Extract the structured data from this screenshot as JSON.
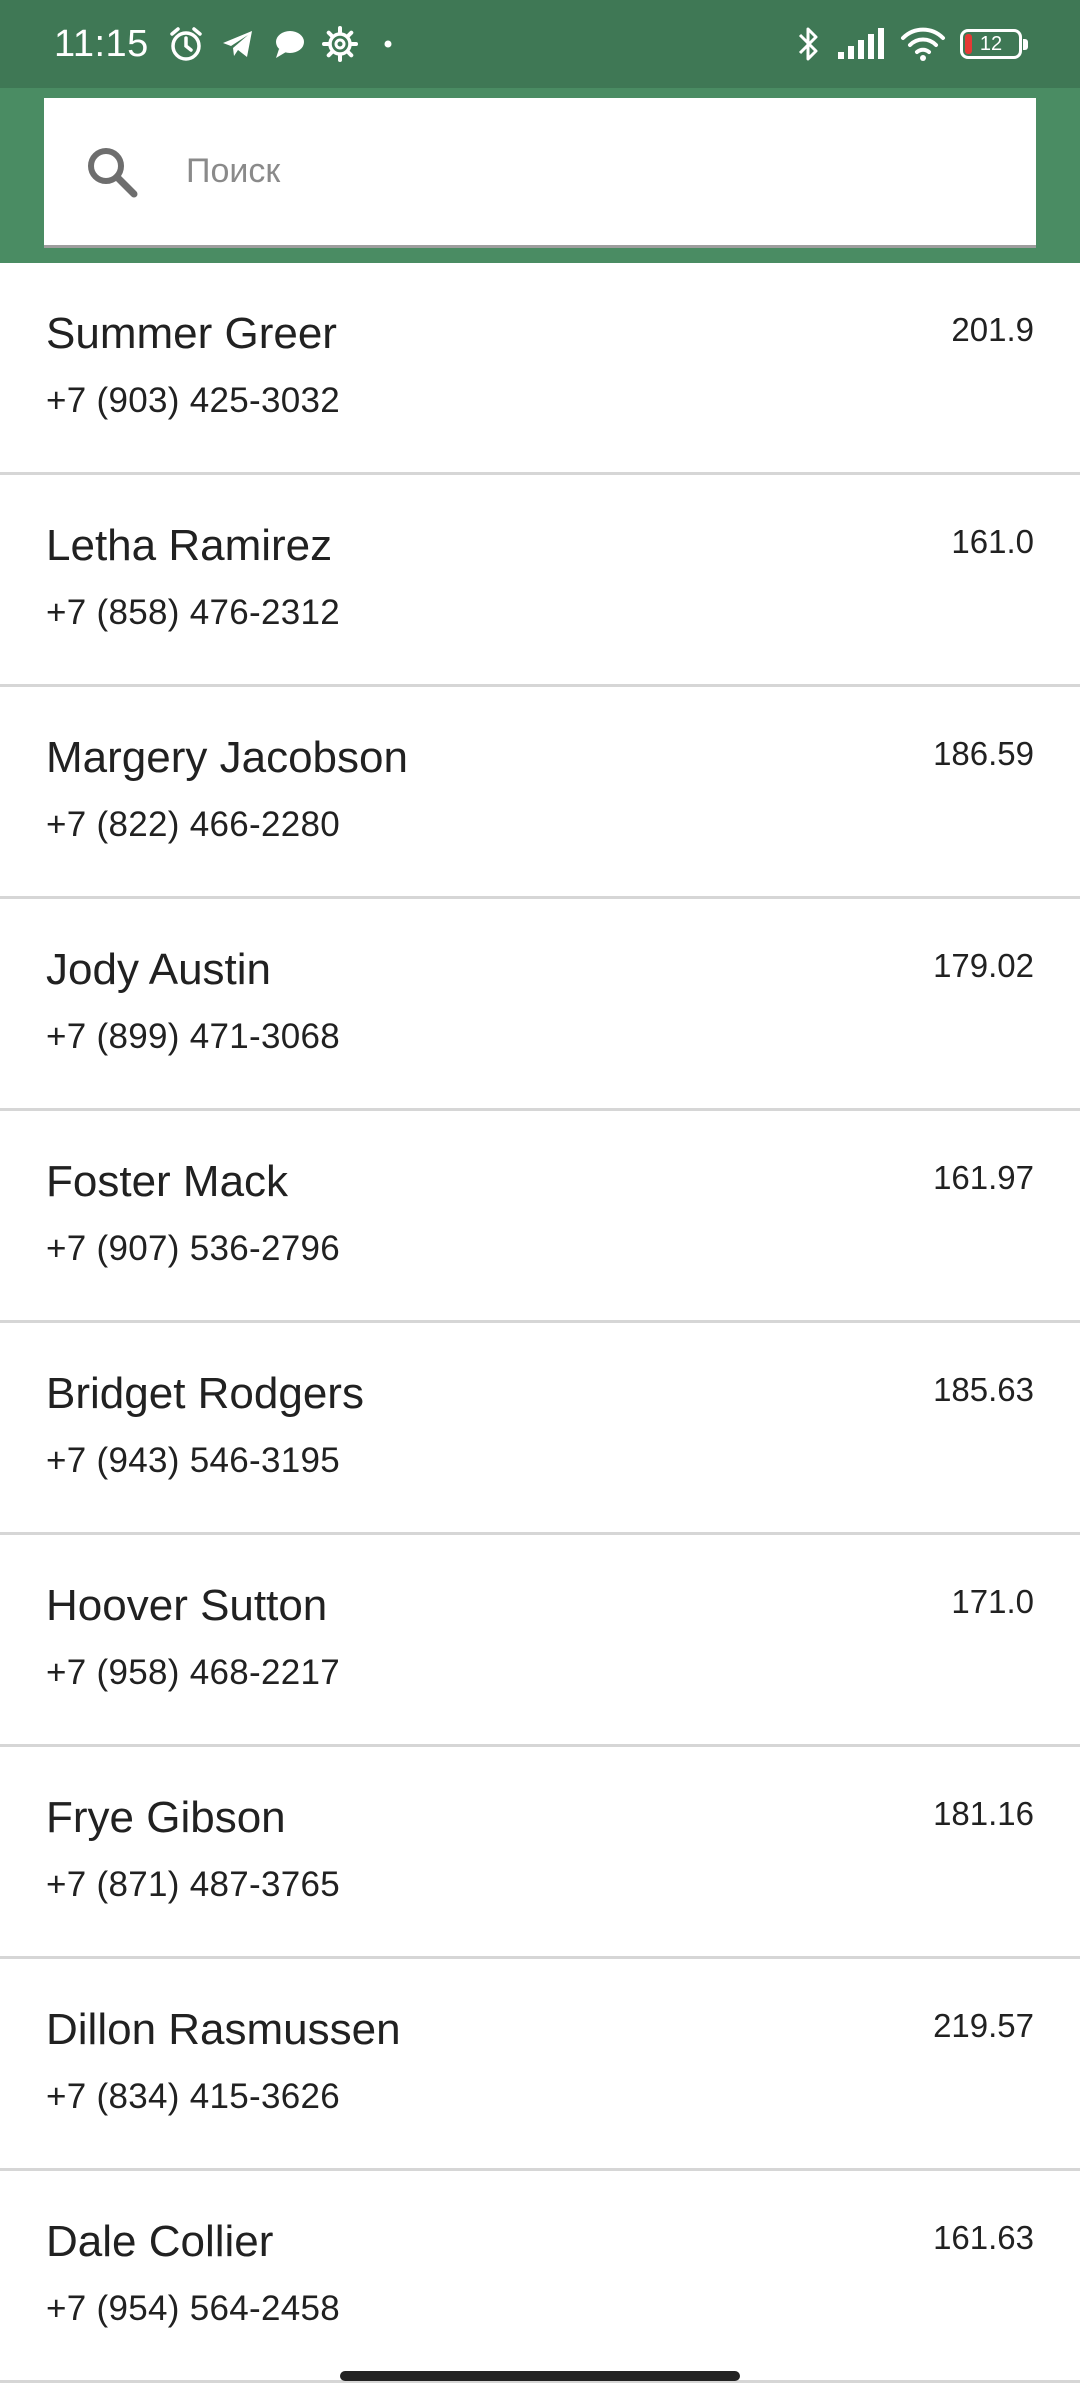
{
  "status_bar": {
    "time": "11:15",
    "battery_level": "12",
    "icons": [
      "alarm-icon",
      "telegram-icon",
      "chat-bubble-icon",
      "settings-icon",
      "dot-icon",
      "bluetooth-icon",
      "signal-icon",
      "wifi-icon",
      "battery-icon"
    ],
    "accent_color": "#3f7855"
  },
  "search": {
    "placeholder": "Поиск",
    "value": "",
    "icon": "search-icon",
    "background_color": "#4a8c63"
  },
  "contacts": [
    {
      "name": "Summer Greer",
      "phone": "+7 (903) 425-3032",
      "value": "201.9"
    },
    {
      "name": "Letha Ramirez",
      "phone": "+7 (858) 476-2312",
      "value": "161.0"
    },
    {
      "name": "Margery Jacobson",
      "phone": "+7 (822) 466-2280",
      "value": "186.59"
    },
    {
      "name": "Jody Austin",
      "phone": "+7 (899) 471-3068",
      "value": "179.02"
    },
    {
      "name": "Foster Mack",
      "phone": "+7 (907) 536-2796",
      "value": "161.97"
    },
    {
      "name": "Bridget Rodgers",
      "phone": "+7 (943) 546-3195",
      "value": "185.63"
    },
    {
      "name": "Hoover Sutton",
      "phone": "+7 (958) 468-2217",
      "value": "171.0"
    },
    {
      "name": "Frye Gibson",
      "phone": "+7 (871) 487-3765",
      "value": "181.16"
    },
    {
      "name": "Dillon Rasmussen",
      "phone": "+7 (834) 415-3626",
      "value": "219.57"
    },
    {
      "name": "Dale Collier",
      "phone": "+7 (954) 564-2458",
      "value": "161.63"
    }
  ]
}
